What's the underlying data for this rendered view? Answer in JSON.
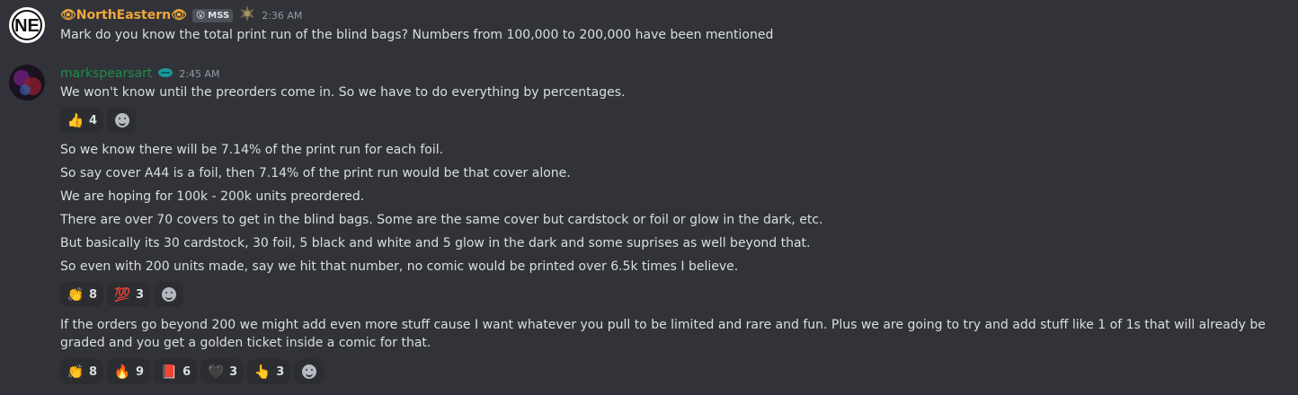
{
  "messages": [
    {
      "author": "👁NorthEastern👁",
      "tag": {
        "emoji": "😮",
        "text": "MSS"
      },
      "badge_icon": "bronze-star-badge-icon",
      "timestamp": "2:36 AM",
      "lines": [
        "Mark do you know the total print run of the blind bags?  Numbers from 100,000 to 200,000 have been mentioned"
      ]
    },
    {
      "author": "markspearsart",
      "badge_icon": "teal-blimp-badge-icon",
      "timestamp": "2:45 AM",
      "blocks": [
        {
          "lines": [
            "We won't know until the preorders come in.  So we have to do everything by percentages."
          ],
          "reactions": [
            {
              "emoji": "👍",
              "count": "4"
            }
          ]
        },
        {
          "lines": [
            "So we know there will be 7.14% of the print run for each foil.",
            "So say cover A44 is a foil, then 7.14% of the print run would be that cover alone.",
            "We are hoping for 100k - 200k units preordered.",
            "There are over 70 covers to get in the blind bags.  Some are the same cover but cardstock or foil or glow in the dark, etc.",
            "But basically its 30 cardstock, 30 foil, 5 black and white and 5 glow in the dark and some suprises as well beyond that.",
            "So even with 200 units made, say we hit that number, no comic would be printed over 6.5k times I believe."
          ],
          "reactions": [
            {
              "emoji": "👏",
              "count": "8"
            },
            {
              "emoji": "💯",
              "count": "3"
            }
          ]
        },
        {
          "lines": [
            "If the orders go beyond 200 we might add even more stuff cause I want whatever you pull to be limited and rare and fun.  Plus we are going to try and add stuff like 1 of 1s that will already be graded and you get a golden ticket inside a comic for that."
          ],
          "reactions": [
            {
              "emoji": "👏",
              "count": "8"
            },
            {
              "emoji": "🔥",
              "count": "9"
            },
            {
              "emoji": "📕",
              "count": "6"
            },
            {
              "emoji": "🖤",
              "count": "3"
            },
            {
              "emoji": "👆",
              "count": "3"
            }
          ]
        }
      ]
    }
  ],
  "add_reaction_icon": "add-reaction-icon",
  "colors": {
    "background": "#313338",
    "reaction_bg": "#2b2d31",
    "author_1": "#f0a73a",
    "author_2": "#1f8b4c"
  }
}
